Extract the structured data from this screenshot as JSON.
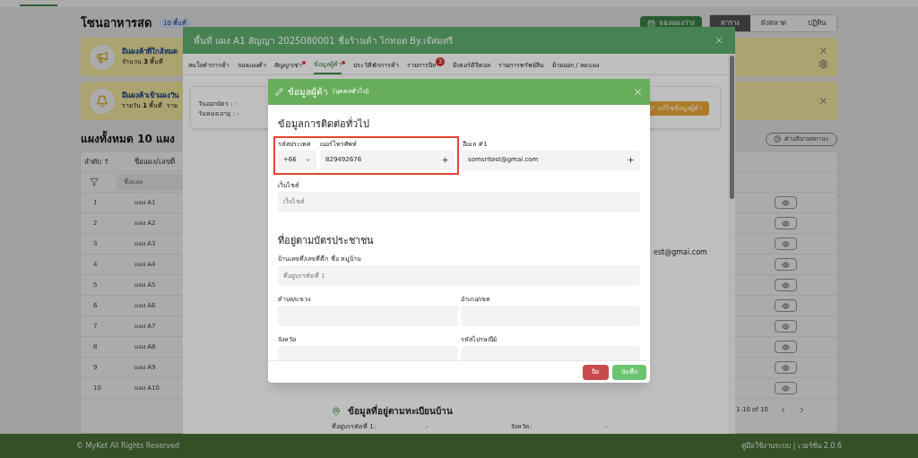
{
  "page": {
    "title": "โซนอาหารสด",
    "badge": "10 พื้นที่",
    "book_button": "จองแผงว่าง",
    "views": [
      {
        "label": "ตาราง",
        "selected": true
      },
      {
        "label": "ผังตลาด",
        "selected": false
      },
      {
        "label": "ปฏิทิน",
        "selected": false
      }
    ],
    "alerts": [
      {
        "kind": "megaphone",
        "title": "มีแผงค้าที่ใกล้หมด",
        "detail": "จำนวน **3** พื้นที่",
        "settings": true
      },
      {
        "kind": "bell",
        "title": "มีแผงค้าเข้าแผงวัน",
        "detail": "รายวัน **1** พื้นที่  ราย",
        "settings": false
      }
    ],
    "heading": "แผงทั้งหมด 10 แผง",
    "legend_button": "คำอธิบายสถานะ",
    "table": {
      "columns": [
        "ลำดับ ↑",
        "ชื่อแผง/เลขที่"
      ],
      "filter_placeholder": "ชื่อแผง",
      "rows": [
        {
          "no": "1",
          "name": "แผง A1"
        },
        {
          "no": "2",
          "name": "แผง A2"
        },
        {
          "no": "3",
          "name": "แผง A3"
        },
        {
          "no": "4",
          "name": "แผง A4"
        },
        {
          "no": "5",
          "name": "แผง A5"
        },
        {
          "no": "6",
          "name": "แผง A6"
        },
        {
          "no": "7",
          "name": "แผง A7"
        },
        {
          "no": "8",
          "name": "แผง A8"
        },
        {
          "no": "9",
          "name": "แผง A9"
        },
        {
          "no": "10",
          "name": "แผง A10"
        }
      ],
      "pagination": "1-10 of 10"
    },
    "footer": {
      "copyright": "© MyKet All Rights Reserved",
      "links": "คู่มือใช้งานระบบ | เวอร์ชั่น 2.0.6"
    }
  },
  "stall_dialog": {
    "title": "พื้นที่ แผง A1 สัญญา 2025080001 ชื่อร้านค้า ไก่ทอด By.เจ๊สมศรี",
    "tabs": [
      {
        "label": "สนใจทำการค้า",
        "selected": false,
        "alert": false
      },
      {
        "label": "จองแผงค้า",
        "selected": false,
        "alert": false
      },
      {
        "label": "สัญญาเช่า",
        "selected": false,
        "alert": true
      },
      {
        "label": "ข้อมูลผู้ค้า",
        "selected": true,
        "alert": true
      },
      {
        "label": "ประวัติพักการค้า",
        "selected": false,
        "alert": false
      },
      {
        "label": "รายการบิล",
        "selected": false,
        "alert": false,
        "badge": "3"
      },
      {
        "label": "มิเตอร์ดิจิตอล",
        "selected": false,
        "alert": false
      },
      {
        "label": "รายการทรัพย์สิน",
        "selected": false,
        "alert": false
      },
      {
        "label": "ย้ายออก / ลดแผง",
        "selected": false,
        "alert": false
      }
    ],
    "card_lines": [
      "วันออกบัตร : -",
      "วันหมดอายุ : -"
    ],
    "edit_button": "แก้ไขข้อมูลผู้ค้า",
    "email_fragment": "est@gmai.com",
    "address_heading": "ข้อมูลที่อยู่ตามทะเบียนบ้าน",
    "address_rows": [
      {
        "label": "ที่อยู่บรรทัดที่ 1:",
        "value": "-"
      },
      {
        "label": "จังหวัด:",
        "value": "-"
      }
    ]
  },
  "trader_dialog": {
    "title": "ข้อมูลผู้ค้า",
    "subtitle": "(บุคคลทั่วไป)",
    "contact_heading": "ข้อมูลการติดต่อทั่วไป",
    "country_code": {
      "label": "รหัสประเทศ",
      "value": "+66"
    },
    "phone": {
      "label": "เบอร์โทรศัพท์",
      "value": "829492676",
      "highlighted": true
    },
    "email": {
      "label": "อีเมล #1",
      "value": "somsritest@gmai.com"
    },
    "website": {
      "label": "เว็บไซต์",
      "placeholder": "เว็บไซต์"
    },
    "id_address_heading": "ที่อยู่ตามบัตรประชาชน",
    "address_fields": [
      {
        "label": "บ้านเลขที่/เลขที่ตึก ชื่อ หมู่บ้าน",
        "placeholder": "ที่อยู่บรรทัดที่ 1",
        "wide": true
      },
      {
        "label": "ตำบล/แขวง",
        "wide": false
      },
      {
        "label": "อำเภอ/เขต",
        "wide": false
      },
      {
        "label": "จังหวัด",
        "wide": false
      },
      {
        "label": "รหัสไปรษณีย์",
        "wide": false
      }
    ],
    "buttons": [
      {
        "label": "ปิด",
        "kind": "danger"
      },
      {
        "label": "บันทึก",
        "kind": "primary"
      }
    ]
  }
}
